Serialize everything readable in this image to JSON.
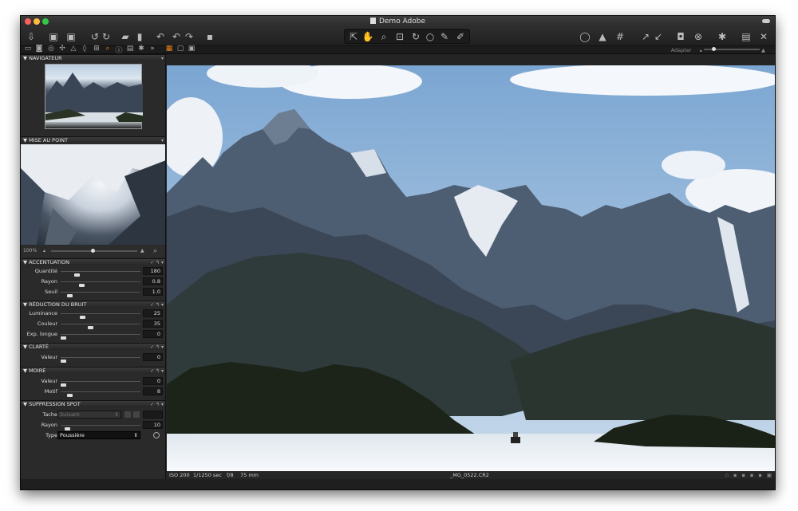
{
  "window": {
    "title": "Demo  Adobe"
  },
  "subtoolbar": {
    "adapter_label": "Adapter"
  },
  "sections": {
    "navigateur": "NAVIGATEUR",
    "mise_au_point": "MISE AU POINT",
    "accentuation": "ACCENTUATION",
    "reduction_bruit": "RÉDUCTION DU BRUIT",
    "clarte": "CLARTÉ",
    "moire": "MOIRÉ",
    "suppression_spot": "SUPPRESSION SPOT"
  },
  "zoom": {
    "percent": "100%"
  },
  "accentuation": {
    "quantite_label": "Quantité",
    "quantite_value": "180",
    "quantite_level": 0.18,
    "rayon_label": "Rayon",
    "rayon_value": "0.8",
    "rayon_level": 0.24,
    "seuil_label": "Seuil",
    "seuil_value": "1.0",
    "seuil_level": 0.08
  },
  "reduction_bruit": {
    "luminance_label": "Luminance",
    "luminance_value": "25",
    "luminance_level": 0.25,
    "couleur_label": "Couleur",
    "couleur_value": "35",
    "couleur_level": 0.35,
    "exp_label": "Exp. longue",
    "exp_value": "0",
    "exp_level": 0.0
  },
  "clarte": {
    "valeur_label": "Valeur",
    "valeur_value": "0",
    "valeur_level": 0.0
  },
  "moire": {
    "valeur_label": "Valeur",
    "valeur_value": "0",
    "valeur_level": 0.0,
    "motif_label": "Motif",
    "motif_value": "8",
    "motif_level": 0.08
  },
  "suppression_spot": {
    "tache_label": "Tache",
    "tache_value": "Suivant",
    "rayon_label": "Rayon",
    "rayon_value": "10",
    "rayon_level": 0.05,
    "type_label": "Type",
    "type_value": "Poussière"
  },
  "statusbar": {
    "iso": "ISO 200",
    "shutter": "1/1250 sec",
    "aperture": "f/8",
    "focal": "75 mm",
    "filename": "_MG_0522.CR2"
  },
  "colors": {
    "accent": "#e8821e",
    "panel": "#2a2a2a",
    "header": "#333333"
  }
}
